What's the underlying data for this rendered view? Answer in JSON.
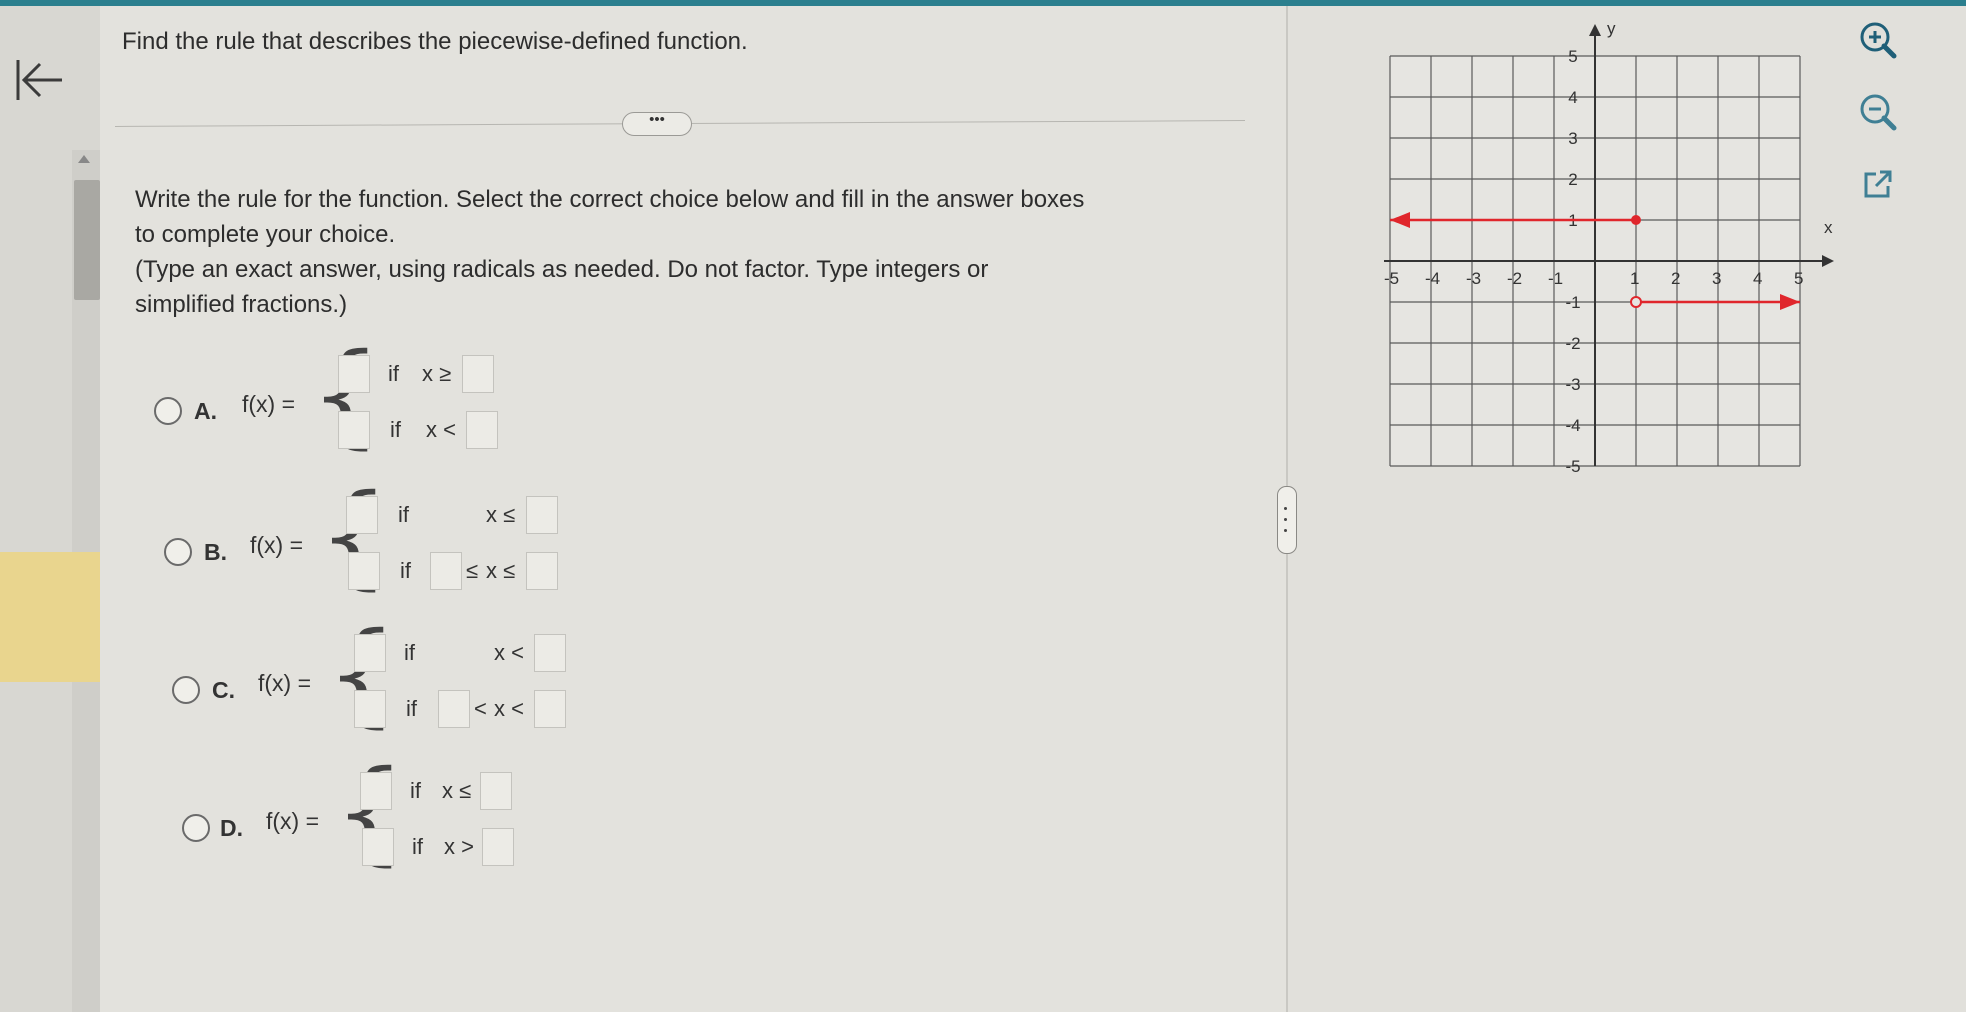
{
  "question": "Find the rule that describes the piecewise-defined function.",
  "more_label": "•••",
  "instructions": {
    "line1": "Write the rule for the function. Select the correct choice below and fill in the answer boxes",
    "line2": "to complete your choice.",
    "line3": "(Type an exact answer, using radicals as needed. Do not factor. Type integers or",
    "line4": "simplified fractions.)"
  },
  "choices": [
    {
      "letter": "A.",
      "fx": "f(x) =",
      "if1": "if",
      "cond1": "x ≥",
      "if2": "if",
      "cond2": "x <"
    },
    {
      "letter": "B.",
      "fx": "f(x) =",
      "if1": "if",
      "cond1": "x ≤",
      "if2": "if",
      "cond2a": "≤",
      "cond2b": "x ≤"
    },
    {
      "letter": "C.",
      "fx": "f(x) =",
      "if1": "if",
      "cond1": "x <",
      "if2": "if",
      "cond2a": "<",
      "cond2b": "x <"
    },
    {
      "letter": "D.",
      "fx": "f(x) =",
      "if1": "if",
      "cond1": "x ≤",
      "if2": "if",
      "cond2": "x >"
    }
  ],
  "graph": {
    "x_label": "x",
    "y_label": "y",
    "x_ticks": [
      "-5",
      "-4",
      "-3",
      "-2",
      "-1",
      "1",
      "2",
      "3",
      "4",
      "5"
    ],
    "y_ticks": [
      "5",
      "4",
      "3",
      "2",
      "1",
      "-1",
      "-2",
      "-3",
      "-4",
      "-5"
    ],
    "xlim": [
      -5,
      5
    ],
    "ylim": [
      -5,
      5
    ],
    "line_color": "#e0262c",
    "segments": [
      {
        "from_x": -5,
        "to_x": 1,
        "y": 1,
        "left_arrow": true,
        "right_endpoint": "closed"
      },
      {
        "from_x": 1,
        "to_x": 5,
        "y": -1,
        "left_endpoint": "open",
        "right_arrow": true
      }
    ]
  },
  "tools": [
    "zoom-in-icon",
    "zoom-out-icon",
    "external-link-icon"
  ]
}
